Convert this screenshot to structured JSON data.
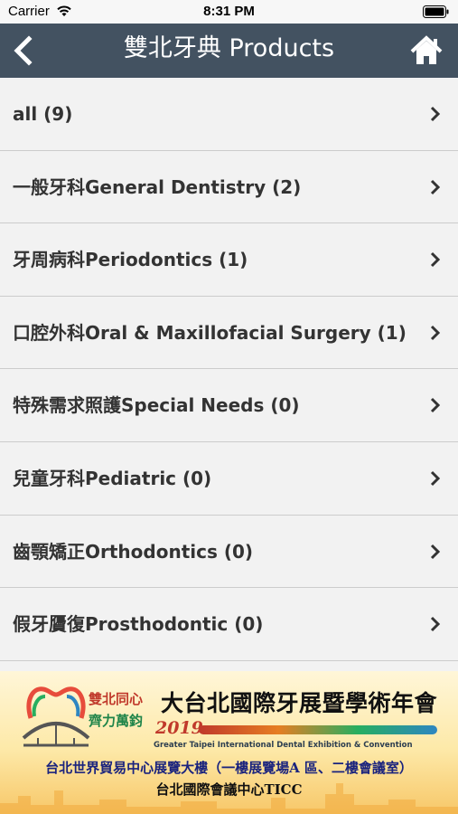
{
  "status_bar": {
    "carrier": "Carrier",
    "time": "8:31 PM"
  },
  "nav": {
    "title": "雙北牙典 Products",
    "back_icon": "chevron-left-icon",
    "home_icon": "home-icon"
  },
  "categories": [
    {
      "label": "all (9)"
    },
    {
      "label": "一般牙科General Dentistry (2)"
    },
    {
      "label": "牙周病科Periodontics (1)"
    },
    {
      "label": "口腔外科Oral & Maxillofacial Surgery (1)"
    },
    {
      "label": "特殊需求照護Special Needs (0)"
    },
    {
      "label": "兒童牙科Pediatric (0)"
    },
    {
      "label": "齒顎矯正Orthodontics (0)"
    },
    {
      "label": "假牙贗復Prosthodontic (0)"
    }
  ],
  "banner": {
    "slogan_line1": "雙北同心",
    "slogan_line2": "齊力萬鈞",
    "title": "大台北國際牙展暨學術年會",
    "year": "2019",
    "subtitle_en": "Greater Taipei International Dental Exhibition & Convention",
    "venue_line1": "台北世界貿易中心展覽大樓（一樓展覽場A 區、二樓會議室）",
    "venue_line2": "台北國際會議中心TICC"
  },
  "colors": {
    "nav_bg": "#435261",
    "list_bg": "#f2f2f2",
    "text": "#333333",
    "divider": "#cccccc"
  }
}
